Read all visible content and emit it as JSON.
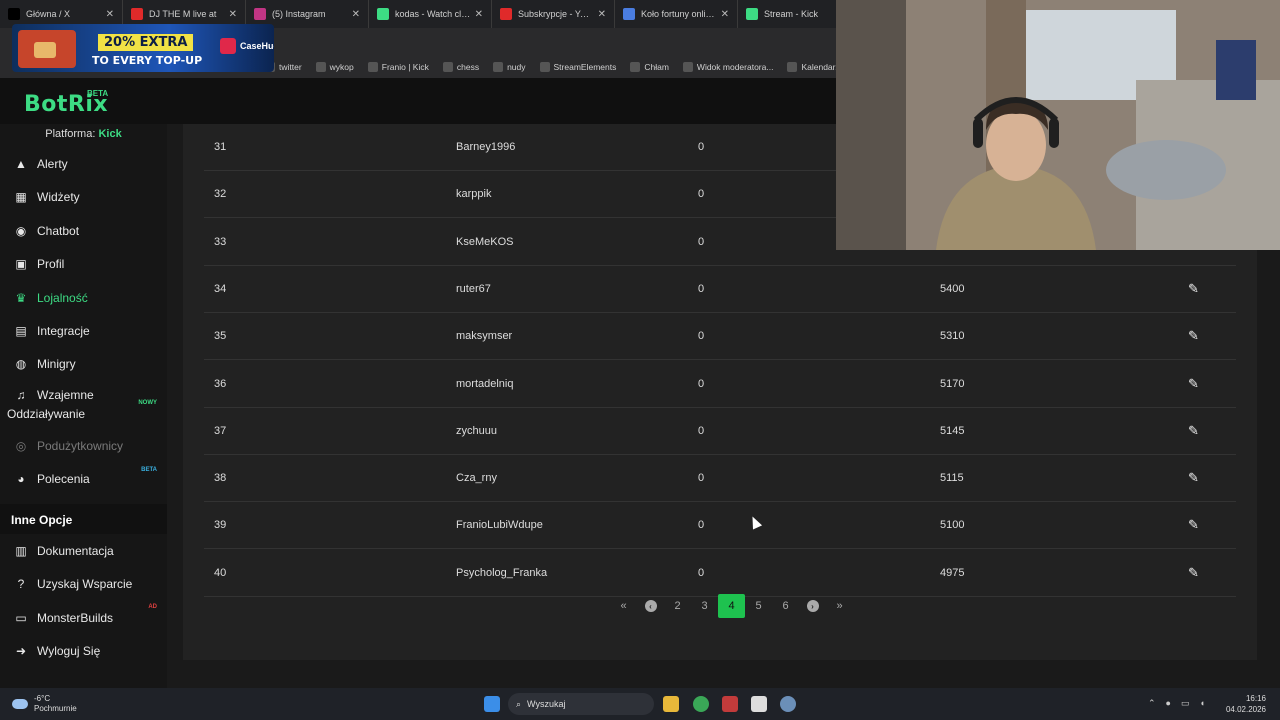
{
  "browser": {
    "tabs": [
      {
        "label": "Główna / X",
        "icon": "x-icon",
        "color": "#000000"
      },
      {
        "label": "DJ THE M live at",
        "icon": "youtube-icon",
        "color": "#e02a2a"
      },
      {
        "label": "(5) Instagram",
        "icon": "instagram-icon",
        "color": "#c13584"
      },
      {
        "label": "kodas - Watch clips o",
        "icon": "kick-icon",
        "color": "#3ddc84"
      },
      {
        "label": "Subskrypcje - YouTub",
        "icon": "youtube-icon",
        "color": "#e02a2a"
      },
      {
        "label": "Koło fortuny online -",
        "icon": "wheel-icon",
        "color": "#4a7de0"
      },
      {
        "label": "Stream - Kick",
        "icon": "kick-icon",
        "color": "#3ddc84"
      }
    ],
    "bookmarks": [
      {
        "label": "twitter",
        "icon": "x-icon"
      },
      {
        "label": "wykop",
        "icon": "wykop-icon"
      },
      {
        "label": "Franio | Kick",
        "icon": "kick-icon"
      },
      {
        "label": "chess",
        "icon": "pawn-icon"
      },
      {
        "label": "nudy",
        "icon": "folder-icon"
      },
      {
        "label": "StreamElements",
        "icon": "streamelements-icon"
      },
      {
        "label": "Chłam",
        "icon": "globe-icon"
      },
      {
        "label": "Widok moderatora...",
        "icon": "twitch-icon"
      },
      {
        "label": "Kalendarz G",
        "icon": "calendar-icon"
      }
    ]
  },
  "ad": {
    "line1": "20% EXTRA",
    "line2": "TO EVERY TOP-UP",
    "brand": "CaseHug"
  },
  "site": {
    "logo": "BotRix",
    "logo_badge": "BETA",
    "platform_label": "Platforma:",
    "platform_value": "Kick"
  },
  "sidebar": {
    "items": [
      {
        "label": "Alerty",
        "icon": "alert-icon"
      },
      {
        "label": "Widżety",
        "icon": "widgets-icon"
      },
      {
        "label": "Chatbot",
        "icon": "robot-icon"
      },
      {
        "label": "Profil",
        "icon": "profile-icon"
      },
      {
        "label": "Lojalność",
        "icon": "trophy-icon"
      },
      {
        "label": "Integracje",
        "icon": "integration-icon"
      },
      {
        "label": "Minigry",
        "icon": "gamepad-icon"
      },
      {
        "label": "Wzajemne",
        "label2": "Oddziaływanie",
        "badge": "NOWY",
        "icon": "music-icon"
      },
      {
        "label": "Podużytkownicy",
        "icon": "users-icon"
      },
      {
        "label": "Polecenia",
        "badge": "BETA",
        "icon": "referral-icon"
      }
    ],
    "section_title": "Inne Opcje",
    "other": [
      {
        "label": "Dokumentacja",
        "icon": "docs-icon"
      },
      {
        "label": "Uzyskaj Wsparcie",
        "icon": "help-icon"
      },
      {
        "label": "MonsterBuilds",
        "badge": "AD",
        "icon": "laptop-icon"
      },
      {
        "label": "Wyloguj Się",
        "icon": "logout-icon"
      }
    ]
  },
  "leaderboard": {
    "rows": [
      {
        "rank": "31",
        "name": "Barney1996",
        "col3": "0",
        "points": ""
      },
      {
        "rank": "32",
        "name": "karppik",
        "col3": "0",
        "points": ""
      },
      {
        "rank": "33",
        "name": "KseMeKOS",
        "col3": "0",
        "points": ""
      },
      {
        "rank": "34",
        "name": "ruter67",
        "col3": "0",
        "points": "5400"
      },
      {
        "rank": "35",
        "name": "maksymser",
        "col3": "0",
        "points": "5310"
      },
      {
        "rank": "36",
        "name": "mortadelniq",
        "col3": "0",
        "points": "5170"
      },
      {
        "rank": "37",
        "name": "zychuuu",
        "col3": "0",
        "points": "5145"
      },
      {
        "rank": "38",
        "name": "Cza_rny",
        "col3": "0",
        "points": "5115"
      },
      {
        "rank": "39",
        "name": "FranioLubiWdupe",
        "col3": "0",
        "points": "5100"
      },
      {
        "rank": "40",
        "name": "Psycholog_Franka",
        "col3": "0",
        "points": "4975"
      }
    ],
    "pagination": {
      "first": "«",
      "prev": "‹",
      "pages": [
        "2",
        "3",
        "4",
        "5",
        "6"
      ],
      "current": "4",
      "next": "›",
      "last": "»"
    }
  },
  "taskbar": {
    "weather_temp": "-6°C",
    "weather_desc": "Pochmurnie",
    "search_placeholder": "Wyszukaj",
    "time": "16:16",
    "date": "04.02.2026"
  }
}
